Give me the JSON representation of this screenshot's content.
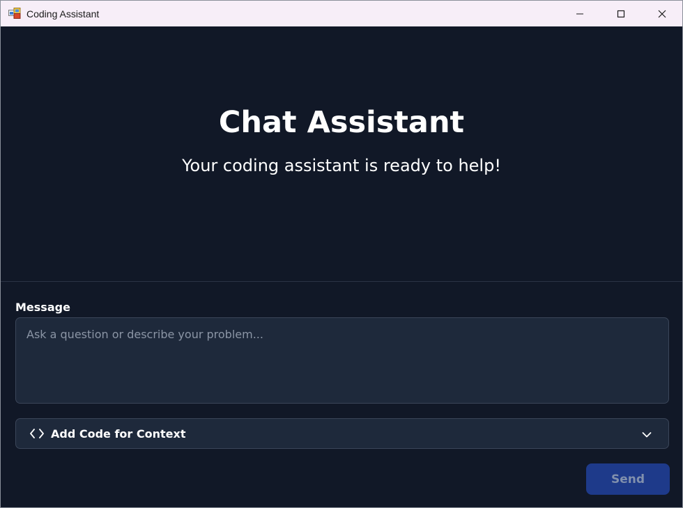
{
  "window": {
    "title": "Coding Assistant",
    "icon": "app-window-icon"
  },
  "hero": {
    "title": "Chat Assistant",
    "subtitle": "Your coding assistant is ready to help!"
  },
  "message": {
    "label": "Message",
    "value": "",
    "placeholder": "Ask a question or describe your problem..."
  },
  "code_context": {
    "label": "Add Code for Context",
    "icon": "code-brackets-icon",
    "expand_icon": "chevron-down-icon",
    "expanded": false
  },
  "send": {
    "label": "Send",
    "disabled": true
  },
  "colors": {
    "background": "#111827",
    "panel": "#1e293b",
    "panel_border": "#3b4659",
    "send_button": "#1e3a8a",
    "send_text": "#8190ad",
    "titlebar": "#f7eef8"
  }
}
